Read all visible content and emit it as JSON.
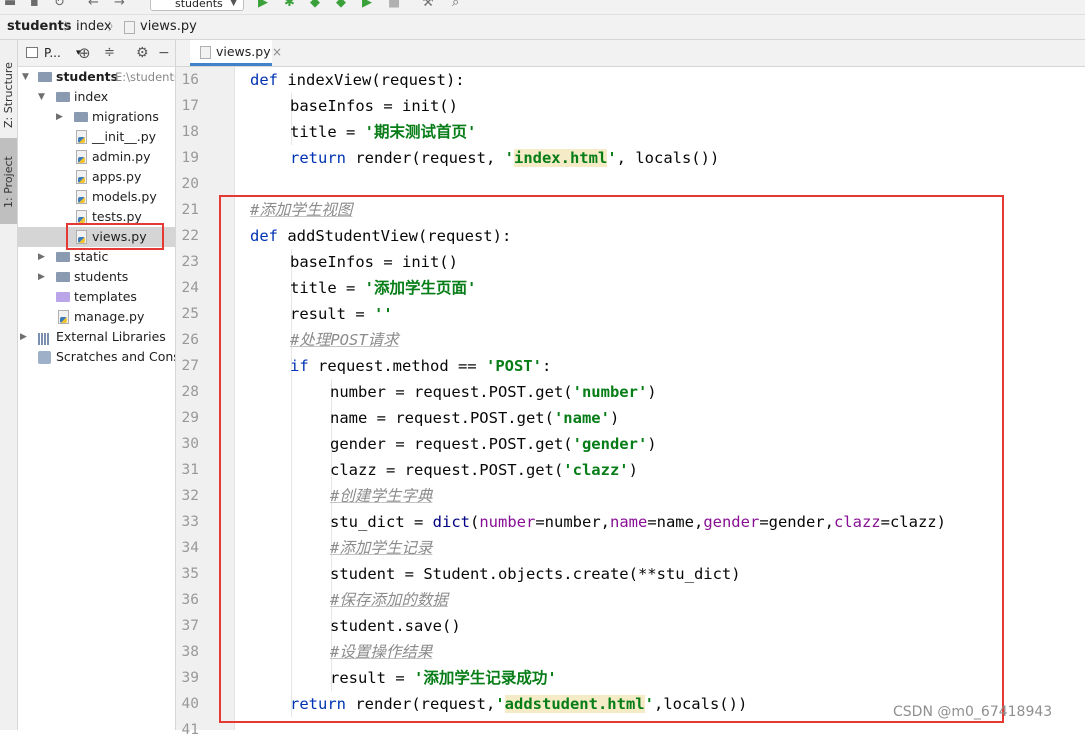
{
  "toolbar": {
    "run_config": "students",
    "icons": [
      "folder-icon",
      "save-icon",
      "sync-icon",
      "back-icon",
      "forward-icon",
      "run-icon",
      "debug-icon",
      "coverage-icon",
      "profile-icon",
      "run-concurrency-icon",
      "stop-icon",
      "build-icon",
      "search-icon"
    ]
  },
  "breadcrumb": [
    "students",
    "index",
    "views.py"
  ],
  "left_tool_tabs": [
    "Z: Structure",
    "1: Project"
  ],
  "project_panel": {
    "header_label": "P...",
    "tree": [
      {
        "label": "students",
        "path": "E:\\students",
        "type": "folder",
        "expanded": true,
        "bold": true
      },
      {
        "label": "index",
        "type": "folder",
        "expanded": true
      },
      {
        "label": "migrations",
        "type": "folder",
        "expanded": false
      },
      {
        "label": "__init__.py",
        "type": "py"
      },
      {
        "label": "admin.py",
        "type": "py"
      },
      {
        "label": "apps.py",
        "type": "py"
      },
      {
        "label": "models.py",
        "type": "py"
      },
      {
        "label": "tests.py",
        "type": "py"
      },
      {
        "label": "views.py",
        "type": "py",
        "selected": true
      },
      {
        "label": "static",
        "type": "folder",
        "expanded": false
      },
      {
        "label": "students",
        "type": "folder",
        "expanded": false
      },
      {
        "label": "templates",
        "type": "folder-purple"
      },
      {
        "label": "manage.py",
        "type": "py"
      },
      {
        "label": "External Libraries",
        "type": "lib",
        "expanded": false
      },
      {
        "label": "Scratches and Consoles",
        "type": "scratch"
      }
    ]
  },
  "editor": {
    "tab_label": "views.py",
    "line_numbers": [
      "16",
      "17",
      "18",
      "19",
      "20",
      "21",
      "22",
      "23",
      "24",
      "25",
      "26",
      "27",
      "28",
      "29",
      "30",
      "31",
      "32",
      "33",
      "34",
      "35",
      "36",
      "37",
      "38",
      "39",
      "40",
      "41"
    ],
    "code": {
      "l16_def": "def ",
      "l16_rest": "indexView(request):",
      "l17": "baseInfos = init()",
      "l18_a": "title = ",
      "l18_s": "'期末测试首页'",
      "l19_kw": "return ",
      "l19_a": "render(request, ",
      "l19_q1": "'",
      "l19_s": "index.html",
      "l19_q2": "'",
      "l19_b": ", locals())",
      "l21": "#添加学生视图",
      "l22_def": "def ",
      "l22_rest": "addStudentView(request):",
      "l23": "baseInfos = init()",
      "l24_a": "title = ",
      "l24_s": "'添加学生页面'",
      "l25_a": "result = ",
      "l25_s": "''",
      "l26": "#处理POST请求",
      "l27_kw": "if ",
      "l27_a": "request.method == ",
      "l27_s": "'POST'",
      "l27_b": ":",
      "l28_a": "number = request.POST.get(",
      "l28_s": "'number'",
      "l28_b": ")",
      "l29_a": "name = request.POST.get(",
      "l29_s": "'name'",
      "l29_b": ")",
      "l30_a": "gender = request.POST.get(",
      "l30_s": "'gender'",
      "l30_b": ")",
      "l31_a": "clazz = request.POST.get(",
      "l31_s": "'clazz'",
      "l31_b": ")",
      "l32": "#创建学生字典",
      "l33_a": "stu_dict = ",
      "l33_dict": "dict",
      "l33_p1": "(",
      "l33_k1": "number",
      "l33_v1": "=number,",
      "l33_k2": "name",
      "l33_v2": "=name,",
      "l33_k3": "gender",
      "l33_v3": "=gender,",
      "l33_k4": "clazz",
      "l33_v4": "=clazz)",
      "l34": "#添加学生记录",
      "l35": "student = Student.objects.create(**stu_dict)",
      "l36": "#保存添加的数据",
      "l37": "student.save()",
      "l38": "#设置操作结果",
      "l39_a": "result = ",
      "l39_s": "'添加学生记录成功'",
      "l40_kw": "return ",
      "l40_a": "render(request,",
      "l40_q1": "'",
      "l40_s": "addstudent.html",
      "l40_q2": "'",
      "l40_b": ",locals())"
    }
  },
  "watermark": "CSDN @m0_67418943",
  "colors": {
    "keyword": "#0033b3",
    "string": "#067d17",
    "comment": "#8c8c8c",
    "param": "#871094",
    "highlight_box": "#e53935"
  }
}
